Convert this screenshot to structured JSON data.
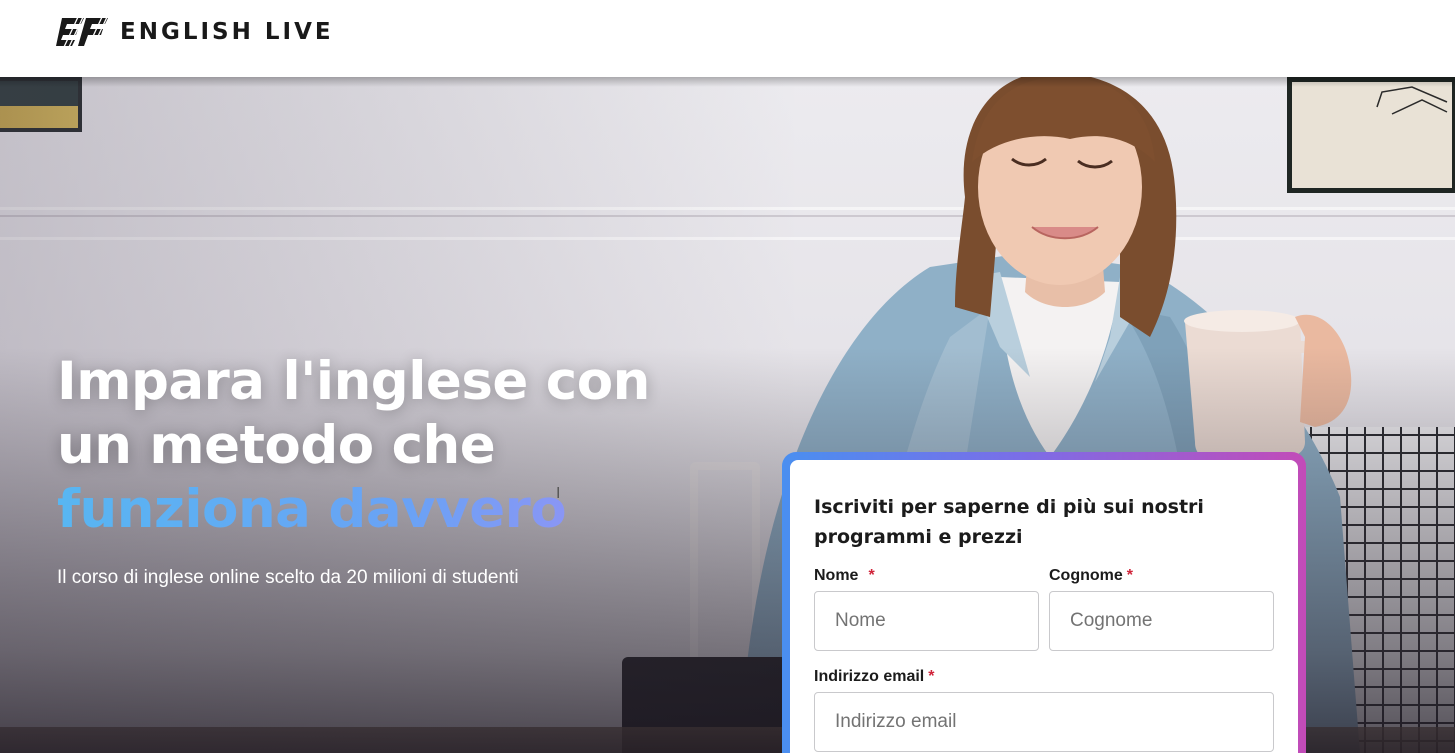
{
  "header": {
    "logo_mark": "EF",
    "logo_text": "ENGLISH LIVE"
  },
  "hero": {
    "title_line_1": "Impara l'inglese con",
    "title_line_2": "un metodo che",
    "title_accent": "funziona davvero",
    "subtitle": "Il corso di inglese online scelto da 20 milioni di studenti"
  },
  "form": {
    "title": "Iscriviti per saperne di più sui nostri programmi e prezzi",
    "required_mark": "*",
    "first_name": {
      "label": "Nome",
      "placeholder": "Nome",
      "value": ""
    },
    "last_name": {
      "label": "Cognome",
      "placeholder": "Cognome",
      "value": ""
    },
    "email": {
      "label": "Indirizzo email",
      "placeholder": "Indirizzo email",
      "value": ""
    }
  },
  "colors": {
    "accent_gradient_start": "#58b6f2",
    "accent_gradient_end": "#a58cf5",
    "form_border_start": "#4a8ff0",
    "form_border_end": "#c24bb8",
    "required": "#d0243a"
  }
}
